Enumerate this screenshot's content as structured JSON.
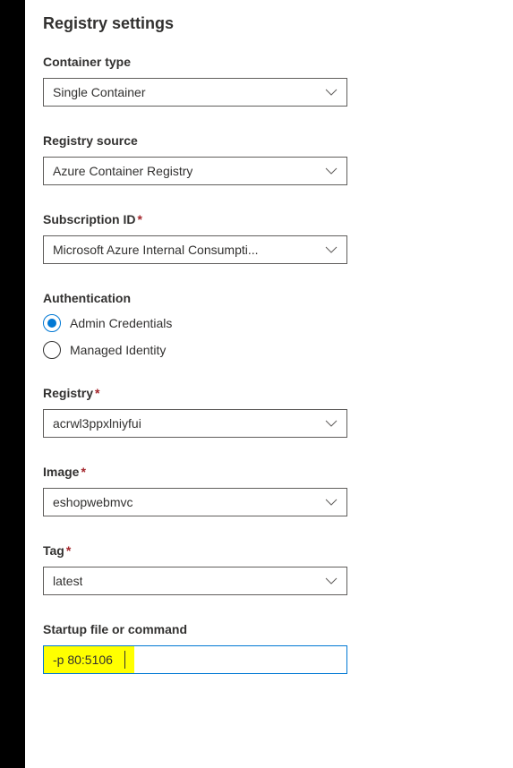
{
  "title": "Registry settings",
  "fields": {
    "container_type": {
      "label": "Container type",
      "value": "Single Container"
    },
    "registry_source": {
      "label": "Registry source",
      "value": "Azure Container Registry"
    },
    "subscription_id": {
      "label": "Subscription ID",
      "required": true,
      "value": "Microsoft Azure Internal Consumpti..."
    },
    "authentication": {
      "label": "Authentication",
      "options": [
        {
          "label": "Admin Credentials",
          "selected": true
        },
        {
          "label": "Managed Identity",
          "selected": false
        }
      ]
    },
    "registry": {
      "label": "Registry",
      "required": true,
      "value": "acrwl3ppxlniyfui"
    },
    "image": {
      "label": "Image",
      "required": true,
      "value": "eshopwebmvc"
    },
    "tag": {
      "label": "Tag",
      "required": true,
      "value": "latest"
    },
    "startup": {
      "label": "Startup file or command",
      "value": "-p 80:5106"
    }
  },
  "required_marker": "*"
}
